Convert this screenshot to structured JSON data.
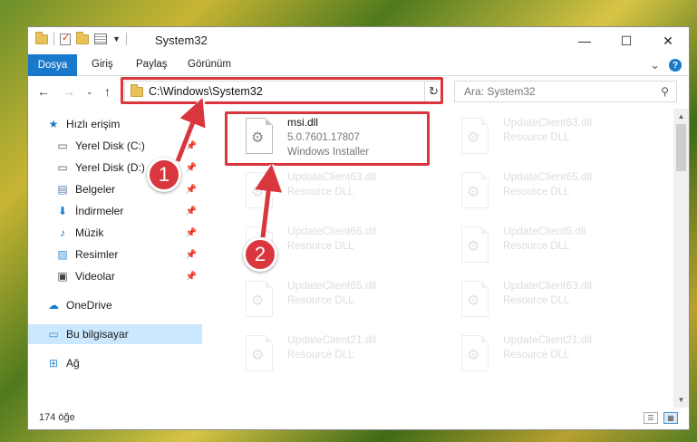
{
  "window": {
    "title": "System32",
    "minimize": "—",
    "maximize": "☐",
    "close": "✕"
  },
  "ribbon": {
    "tabs": [
      "Dosya",
      "Giriş",
      "Paylaş",
      "Görünüm"
    ],
    "expand": "⌄",
    "help": "?"
  },
  "address": {
    "path": "C:\\Windows\\System32",
    "search_placeholder": "Ara: System32"
  },
  "sidebar": {
    "items": [
      {
        "label": "Hızlı erişim",
        "icon": "star-icon",
        "pinned": false
      },
      {
        "label": "Yerel Disk (C:)",
        "icon": "drive-icon",
        "pinned": true
      },
      {
        "label": "Yerel Disk (D:)",
        "icon": "drive-icon",
        "pinned": true
      },
      {
        "label": "Belgeler",
        "icon": "document-icon",
        "pinned": true
      },
      {
        "label": "İndirmeler",
        "icon": "download-icon",
        "pinned": true
      },
      {
        "label": "Müzik",
        "icon": "music-icon",
        "pinned": true
      },
      {
        "label": "Resimler",
        "icon": "picture-icon",
        "pinned": true
      },
      {
        "label": "Videolar",
        "icon": "video-icon",
        "pinned": true
      },
      {
        "label": "OneDrive",
        "icon": "cloud-icon",
        "pinned": false
      },
      {
        "label": "Bu bilgisayar",
        "icon": "computer-icon",
        "pinned": false,
        "selected": true
      },
      {
        "label": "Ağ",
        "icon": "network-icon",
        "pinned": false
      }
    ]
  },
  "files": [
    {
      "name": "msi.dll",
      "line2": "5.0.7601.17807",
      "line3": "Windows Installer",
      "highlighted": true
    },
    {
      "name": "UpdateClient63.dll",
      "line2": "Resource DLL"
    },
    {
      "name": "UpdateClient63.dll",
      "line2": "Resource DLL"
    },
    {
      "name": "UpdateClient65.dll",
      "line2": "Resource DLL"
    },
    {
      "name": "UpdateClient65.dll",
      "line2": "Resource DLL"
    },
    {
      "name": "UpdateClient5.dll",
      "line2": "Resource DLL"
    },
    {
      "name": "UpdateClient65.dll",
      "line2": "Resource DLL"
    },
    {
      "name": "UpdateClient63.dll",
      "line2": "Resource DLL"
    },
    {
      "name": "UpdateClient21.dll",
      "line2": "Resource DLL"
    },
    {
      "name": "UpdateClient21.dll",
      "line2": "Resource DLL"
    }
  ],
  "status": {
    "item_count": "174 öğe"
  },
  "callouts": [
    "1",
    "2"
  ],
  "colors": {
    "accent": "#1979ca",
    "highlight_red": "#d9363e",
    "selected_bg": "#cce8ff"
  }
}
